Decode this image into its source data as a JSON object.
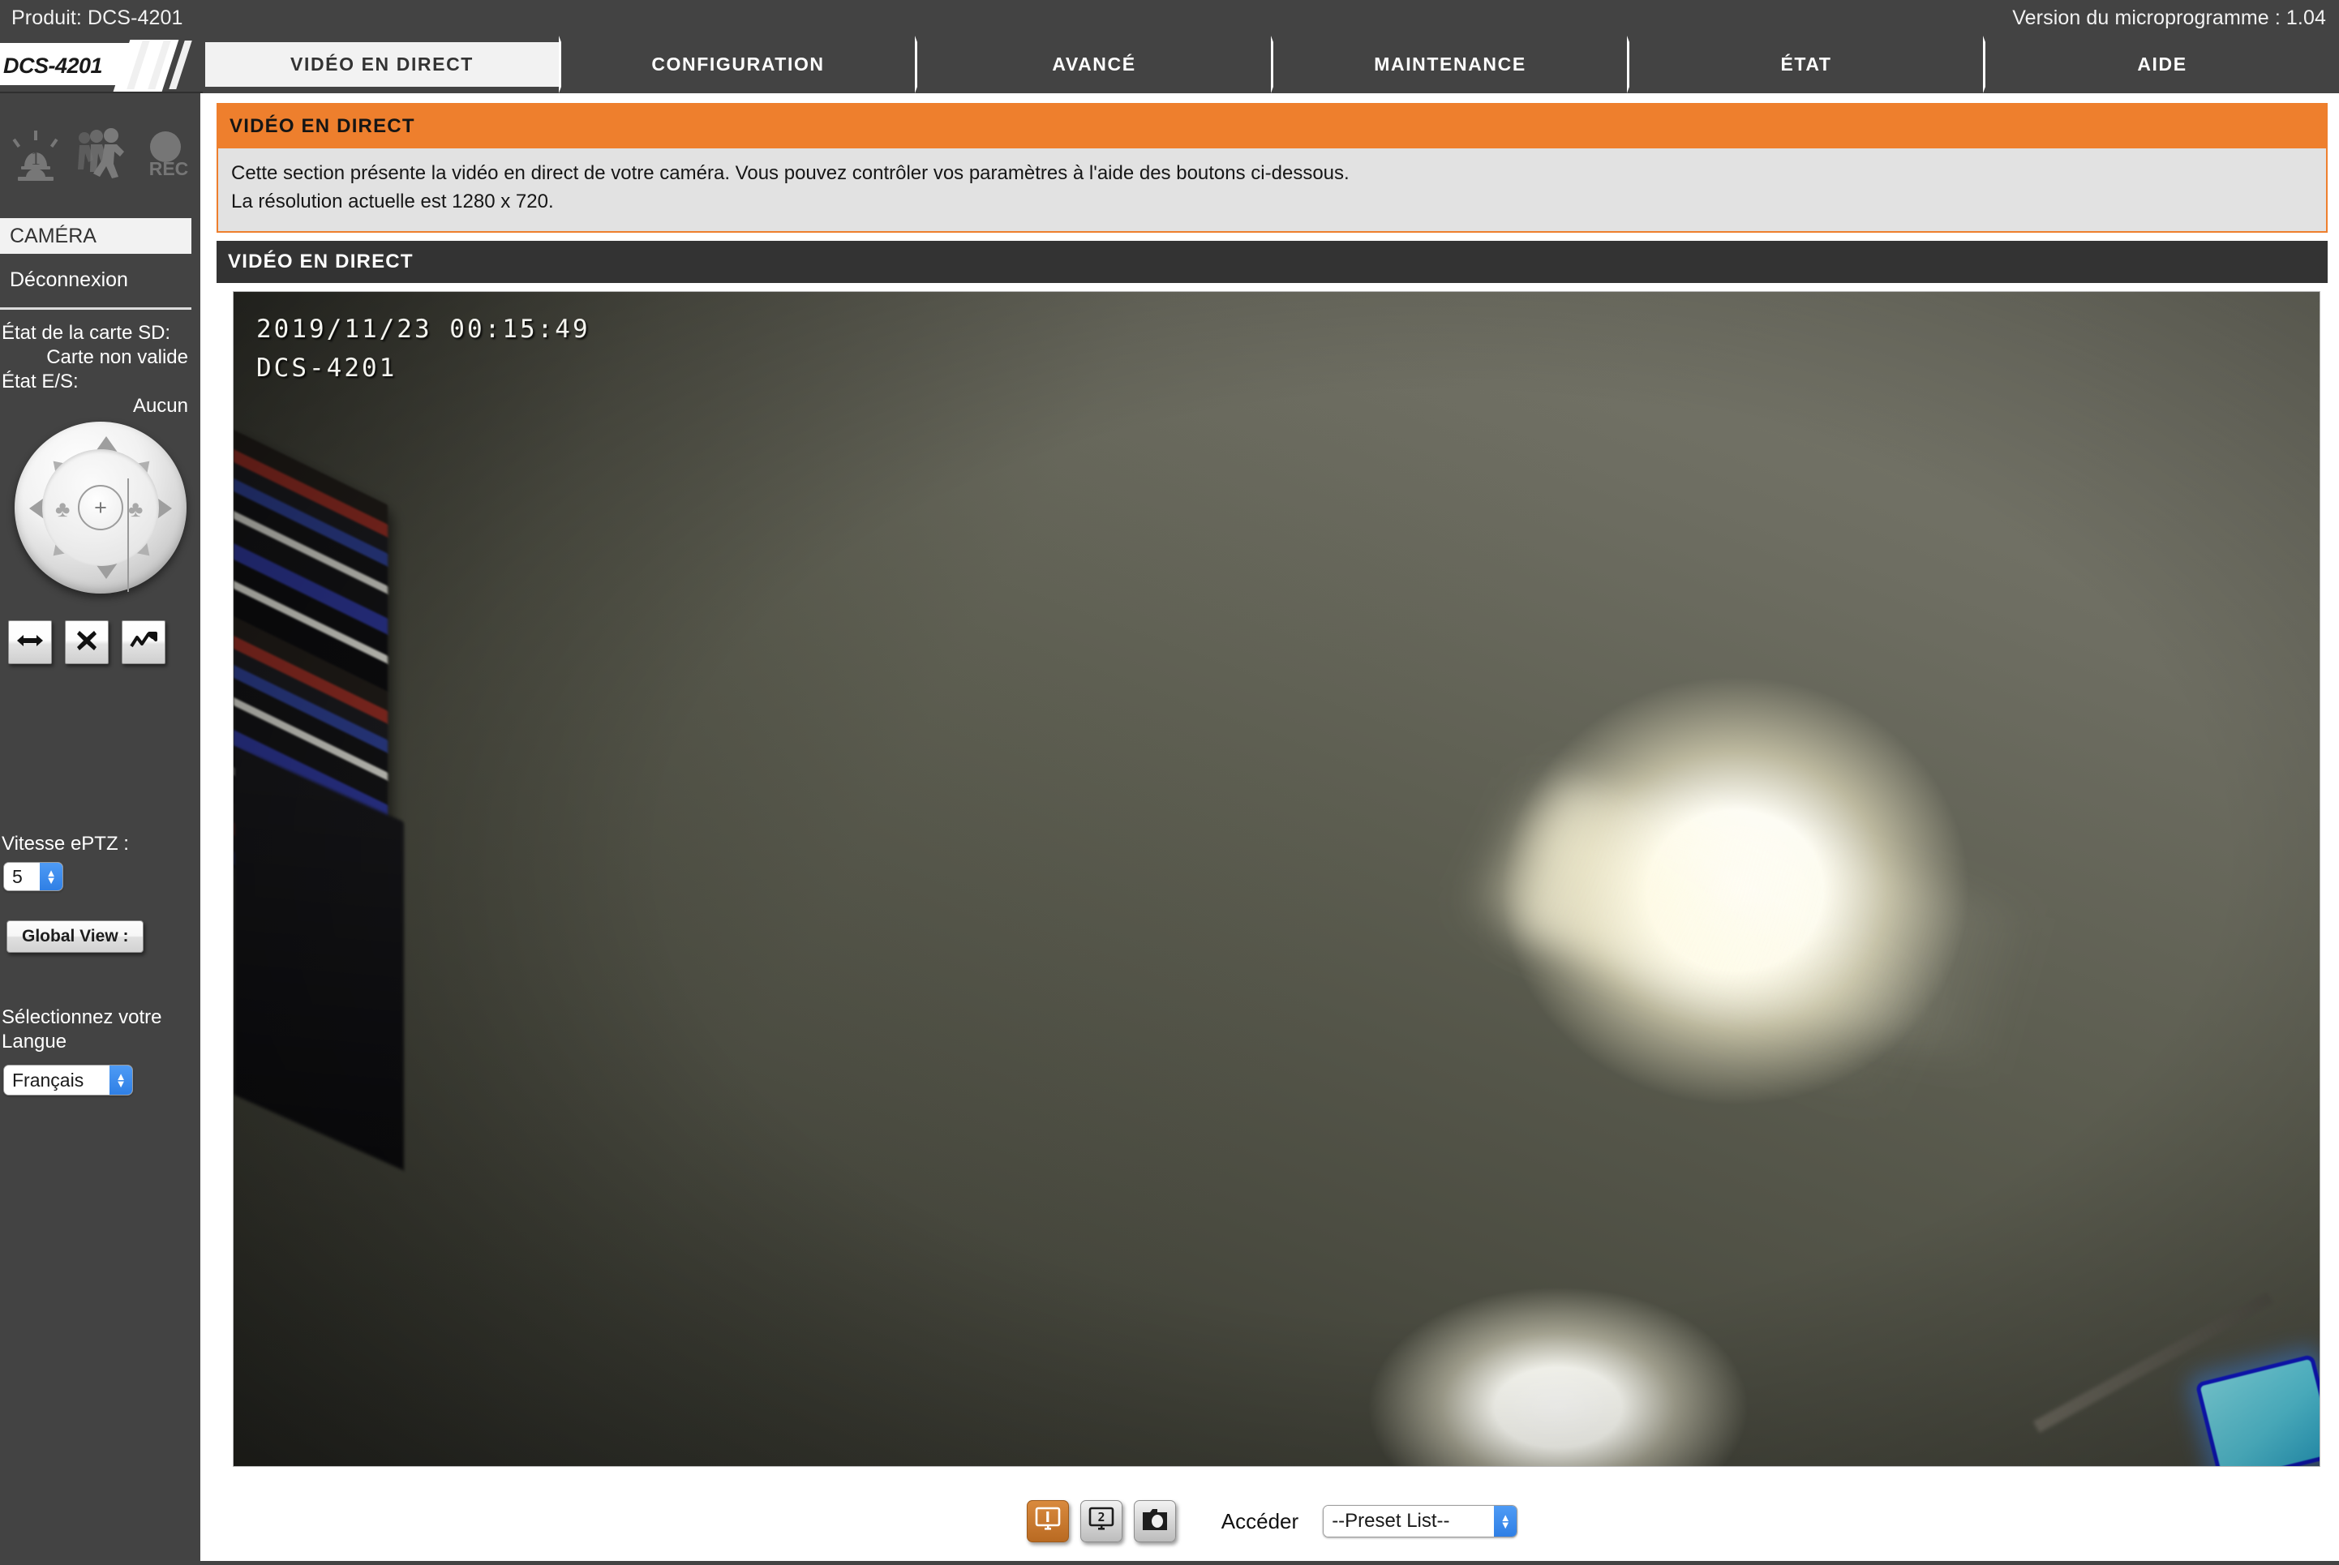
{
  "topbar": {
    "product": "Produit: DCS-4201",
    "firmware": "Version du microprogramme : 1.04"
  },
  "logo": {
    "model": "DCS-4201"
  },
  "tabs": [
    {
      "label": "VIDÉO EN DIRECT",
      "active": true
    },
    {
      "label": "CONFIGURATION",
      "active": false
    },
    {
      "label": "AVANCÉ",
      "active": false
    },
    {
      "label": "MAINTENANCE",
      "active": false
    },
    {
      "label": "ÉTAT",
      "active": false
    },
    {
      "label": "AIDE",
      "active": false
    }
  ],
  "sidebar": {
    "status_icons": [
      "alarm-siren-icon",
      "motion-detect-icon",
      "rec-indicator-icon"
    ],
    "menu": [
      {
        "label": "CAMÉRA",
        "selected": true
      },
      {
        "label": "Déconnexion",
        "selected": false
      }
    ],
    "status": [
      {
        "label": "État de la carte SD:",
        "value": "Carte non valide"
      },
      {
        "label": "État E/S:",
        "value": "Aucun"
      }
    ],
    "ptz": {
      "home_glyph": "+",
      "zoom_in_glyph": "♣",
      "zoom_out_glyph": "♣"
    },
    "pan_buttons": [
      "pan-horizontal-icon",
      "stop-icon",
      "patrol-icon"
    ],
    "eptz_speed_label": "Vitesse ePTZ :",
    "eptz_speed_value": "5",
    "global_view_label": "Global View :",
    "language_label": "Sélectionnez votre Langue",
    "language_value": "Français"
  },
  "main": {
    "banner_title": "VIDÉO EN DIRECT",
    "banner_line1": "Cette section présente la vidéo en direct de votre caméra. Vous pouvez contrôler vos paramètres à l'aide des boutons ci-dessous.",
    "banner_line2": "La résolution actuelle est 1280 x 720.",
    "section_title": "VIDÉO EN DIRECT",
    "osd_timestamp": "2019/11/23 00:15:49",
    "osd_camera": "DCS-4201"
  },
  "bottombar": {
    "profile1": "1",
    "profile2": "2",
    "snapshot_icon": "camera-snapshot-icon",
    "acceder_label": "Accéder",
    "preset_value": "--Preset List--"
  },
  "colors": {
    "accent_orange": "#ee7f2d",
    "chrome_dark": "#434343",
    "section_dark": "#333333",
    "select_blue": "#2f7fe5"
  }
}
